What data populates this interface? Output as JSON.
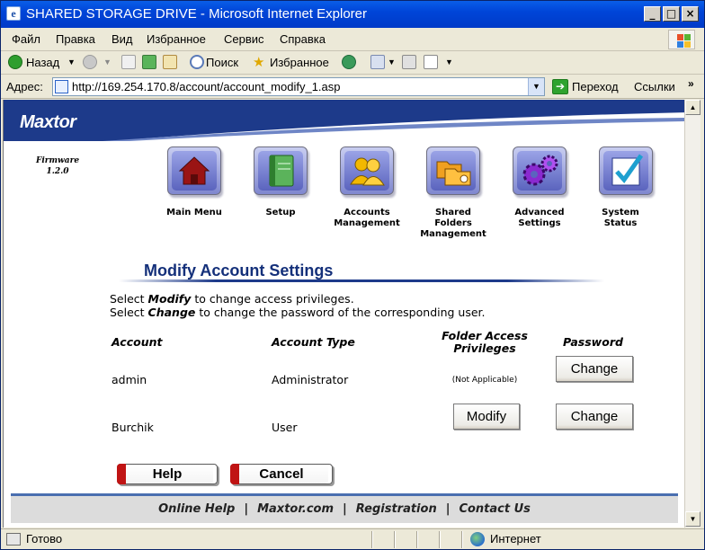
{
  "window": {
    "title": "SHARED STORAGE DRIVE - Microsoft Internet Explorer",
    "minimize": "_",
    "maximize": "□",
    "close": "×"
  },
  "menu": [
    "Файл",
    "Правка",
    "Вид",
    "Избранное",
    "Сервис",
    "Справка"
  ],
  "toolbar": {
    "back": "Назад",
    "search": "Поиск",
    "favorites": "Избранное"
  },
  "address": {
    "label": "Адрес:",
    "url": "http://169.254.170.8/account/account_modify_1.asp",
    "go": "Переход",
    "links": "Ссылки",
    "chevron": "»"
  },
  "page": {
    "logo": "Maxtor",
    "firmware_label": "Firmware",
    "firmware_version": "1.2.0",
    "nav": [
      {
        "label": "Main Menu",
        "icon": "house-icon"
      },
      {
        "label": "Setup",
        "icon": "book-icon"
      },
      {
        "label": "Accounts Management",
        "icon": "users-icon"
      },
      {
        "label": "Shared Folders Management",
        "icon": "folders-icon"
      },
      {
        "label": "Advanced Settings",
        "icon": "gears-icon"
      },
      {
        "label": "System Status",
        "icon": "checkmark-icon"
      }
    ],
    "section_title": "Modify Account Settings",
    "instructions": [
      {
        "pre": "Select ",
        "keyword": "Modify",
        "post": " to change access privileges."
      },
      {
        "pre": "Select ",
        "keyword": "Change",
        "post": " to change the password of the corresponding user."
      }
    ],
    "table": {
      "headers": {
        "account": "Account",
        "account_type": "Account Type",
        "folder_access": "Folder Access Privileges",
        "password": "Password"
      },
      "rows": [
        {
          "account": "admin",
          "type": "Administrator",
          "folder_access": "(Not Applicable)",
          "password_button": "Change"
        },
        {
          "account": "Burchik",
          "type": "User",
          "folder_access_button": "Modify",
          "password_button": "Change"
        }
      ]
    },
    "help_button": "Help",
    "cancel_button": "Cancel",
    "footer": [
      "Online Help",
      "Maxtor.com",
      "Registration",
      "Contact Us"
    ],
    "footer_separator": "|"
  },
  "status": {
    "text": "Готово",
    "zone": "Интернет"
  }
}
